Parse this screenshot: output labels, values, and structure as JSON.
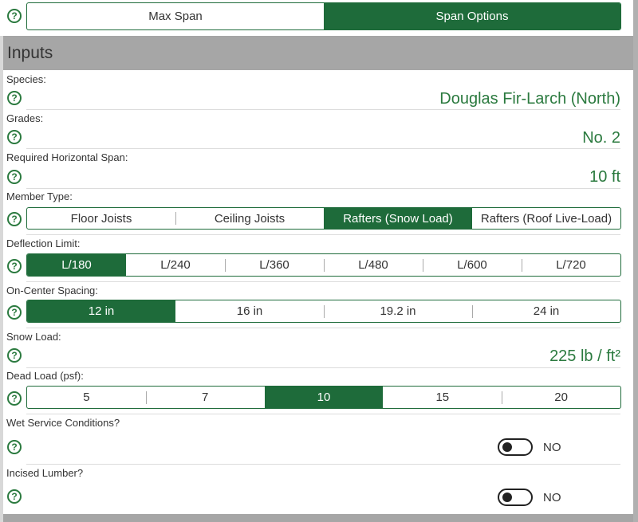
{
  "mode_tabs": [
    "Max Span",
    "Span Options"
  ],
  "section_title": "Inputs",
  "species": {
    "label": "Species:",
    "value": "Douglas Fir-Larch (North)"
  },
  "grades": {
    "label": "Grades:",
    "value": "No. 2"
  },
  "span": {
    "label": "Required Horizontal Span:",
    "value": "10 ft"
  },
  "member_type": {
    "label": "Member Type:",
    "options": [
      "Floor Joists",
      "Ceiling Joists",
      "Rafters (Snow Load)",
      "Rafters (Roof Live-Load)"
    ],
    "selected": "Rafters (Snow Load)"
  },
  "deflection": {
    "label": "Deflection Limit:",
    "options": [
      "L/180",
      "L/240",
      "L/360",
      "L/480",
      "L/600",
      "L/720"
    ],
    "selected": "L/180"
  },
  "spacing": {
    "label": "On-Center Spacing:",
    "options": [
      "12 in",
      "16 in",
      "19.2 in",
      "24 in"
    ],
    "selected": "12 in"
  },
  "snow_load": {
    "label": "Snow Load:",
    "value": "225 lb / ft²"
  },
  "dead_load": {
    "label": "Dead Load (psf):",
    "options": [
      "5",
      "7",
      "10",
      "15",
      "20"
    ],
    "selected": "10"
  },
  "wet_service": {
    "label": "Wet Service Conditions?",
    "state": "NO"
  },
  "incised": {
    "label": "Incised Lumber?",
    "state": "NO"
  },
  "colors": {
    "accent": "#1e6b3a",
    "value_text": "#2b7a3f",
    "header_bg": "#a6a6a6"
  },
  "icons": {
    "help": "help-circle-icon"
  }
}
